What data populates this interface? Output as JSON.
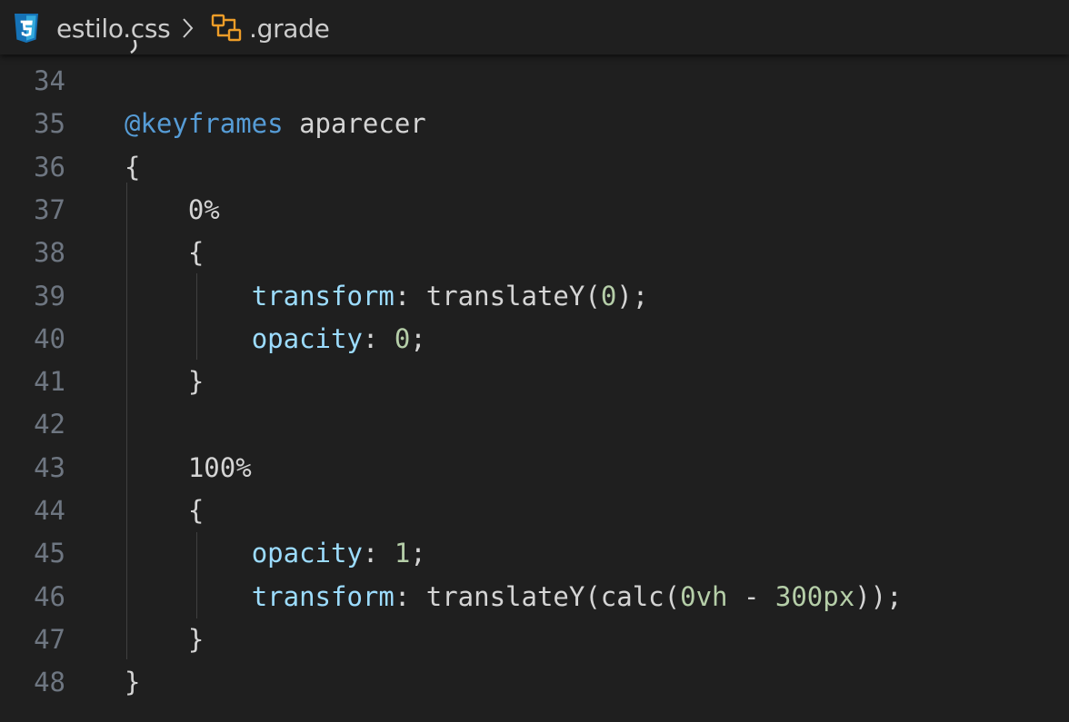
{
  "breadcrumb": {
    "file_icon": "css3-file-icon",
    "file_name": "estilo.css",
    "separator_icon": "chevron-right-icon",
    "symbol_icon": "css-selector-symbol-icon",
    "symbol_name": ".grade"
  },
  "colors": {
    "background": "#1f1f1f",
    "line_number": "#6e7681",
    "keyword": "#569cd6",
    "property": "#9cdcfe",
    "number": "#b5cea8",
    "text": "#d4d4d4",
    "css_icon": "#1572b6",
    "symbol_icon": "#ee9d28"
  },
  "code": {
    "lines": [
      {
        "number": "34",
        "tokens": []
      },
      {
        "number": "35",
        "tokens": [
          {
            "t": "@keyframes",
            "c": "at"
          },
          {
            "t": " aparecer",
            "c": "plain"
          }
        ]
      },
      {
        "number": "36",
        "tokens": [
          {
            "t": "{",
            "c": "punc"
          }
        ]
      },
      {
        "number": "37",
        "tokens": [
          {
            "t": "    0%",
            "c": "plain"
          }
        ]
      },
      {
        "number": "38",
        "tokens": [
          {
            "t": "    {",
            "c": "punc"
          }
        ]
      },
      {
        "number": "39",
        "tokens": [
          {
            "t": "        ",
            "c": "plain"
          },
          {
            "t": "transform",
            "c": "prop"
          },
          {
            "t": ": translateY(",
            "c": "plain"
          },
          {
            "t": "0",
            "c": "num"
          },
          {
            "t": ");",
            "c": "plain"
          }
        ]
      },
      {
        "number": "40",
        "tokens": [
          {
            "t": "        ",
            "c": "plain"
          },
          {
            "t": "opacity",
            "c": "prop"
          },
          {
            "t": ": ",
            "c": "plain"
          },
          {
            "t": "0",
            "c": "num"
          },
          {
            "t": ";",
            "c": "plain"
          }
        ]
      },
      {
        "number": "41",
        "tokens": [
          {
            "t": "    }",
            "c": "punc"
          }
        ]
      },
      {
        "number": "42",
        "tokens": []
      },
      {
        "number": "43",
        "tokens": [
          {
            "t": "    100%",
            "c": "plain"
          }
        ]
      },
      {
        "number": "44",
        "tokens": [
          {
            "t": "    {",
            "c": "punc"
          }
        ]
      },
      {
        "number": "45",
        "tokens": [
          {
            "t": "        ",
            "c": "plain"
          },
          {
            "t": "opacity",
            "c": "prop"
          },
          {
            "t": ": ",
            "c": "plain"
          },
          {
            "t": "1",
            "c": "num"
          },
          {
            "t": ";",
            "c": "plain"
          }
        ]
      },
      {
        "number": "46",
        "tokens": [
          {
            "t": "        ",
            "c": "plain"
          },
          {
            "t": "transform",
            "c": "prop"
          },
          {
            "t": ": translateY(calc(",
            "c": "plain"
          },
          {
            "t": "0vh",
            "c": "num"
          },
          {
            "t": " - ",
            "c": "plain"
          },
          {
            "t": "300px",
            "c": "num"
          },
          {
            "t": "));",
            "c": "plain"
          }
        ]
      },
      {
        "number": "47",
        "tokens": [
          {
            "t": "    }",
            "c": "punc"
          }
        ]
      },
      {
        "number": "48",
        "tokens": [
          {
            "t": "}",
            "c": "punc"
          }
        ]
      }
    ]
  }
}
